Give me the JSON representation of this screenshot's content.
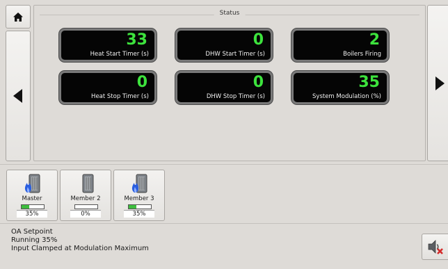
{
  "status": {
    "title": "Status",
    "tiles": [
      {
        "value": "33",
        "label": "Heat Start Timer (s)"
      },
      {
        "value": "0",
        "label": "DHW Start Timer (s)"
      },
      {
        "value": "2",
        "label": "Boilers Firing"
      },
      {
        "value": "0",
        "label": "Heat Stop Timer (s)"
      },
      {
        "value": "0",
        "label": "DHW Stop Timer (s)"
      },
      {
        "value": "35",
        "label": "System Modulation (%)"
      }
    ]
  },
  "members": [
    {
      "name": "Master",
      "percent": "35%",
      "level": 0.35,
      "firing": true
    },
    {
      "name": "Member 2",
      "percent": "0%",
      "level": 0,
      "firing": false
    },
    {
      "name": "Member 3",
      "percent": "35%",
      "level": 0.35,
      "firing": true
    }
  ],
  "messages": {
    "line1": "OA Setpoint",
    "line2": "Running 35%",
    "line3": "Input Clamped at Modulation Maximum"
  },
  "icons": {
    "home": "home-icon",
    "left": "arrow-left-icon",
    "right": "arrow-right-icon",
    "mute": "speaker-muted-icon",
    "boiler": "boiler-icon",
    "flame": "flame-icon"
  },
  "colors": {
    "value_green": "#3de33d",
    "tile_bg": "#050505",
    "flame_blue": "#2a5fe0",
    "bar_green": "#3dbd3d",
    "mute_red": "#d42a2a"
  }
}
